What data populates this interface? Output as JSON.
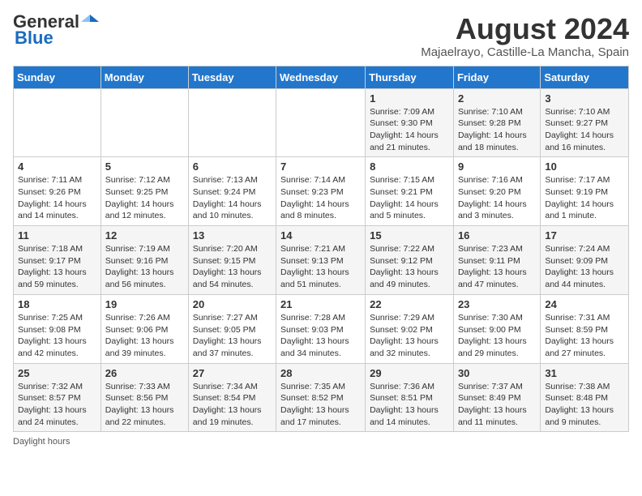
{
  "header": {
    "logo_general": "General",
    "logo_blue": "Blue",
    "title": "August 2024",
    "subtitle": "Majaelrayo, Castille-La Mancha, Spain"
  },
  "days_of_week": [
    "Sunday",
    "Monday",
    "Tuesday",
    "Wednesday",
    "Thursday",
    "Friday",
    "Saturday"
  ],
  "weeks": [
    [
      {
        "day": "",
        "info": ""
      },
      {
        "day": "",
        "info": ""
      },
      {
        "day": "",
        "info": ""
      },
      {
        "day": "",
        "info": ""
      },
      {
        "day": "1",
        "info": "Sunrise: 7:09 AM\nSunset: 9:30 PM\nDaylight: 14 hours and 21 minutes."
      },
      {
        "day": "2",
        "info": "Sunrise: 7:10 AM\nSunset: 9:28 PM\nDaylight: 14 hours and 18 minutes."
      },
      {
        "day": "3",
        "info": "Sunrise: 7:10 AM\nSunset: 9:27 PM\nDaylight: 14 hours and 16 minutes."
      }
    ],
    [
      {
        "day": "4",
        "info": "Sunrise: 7:11 AM\nSunset: 9:26 PM\nDaylight: 14 hours and 14 minutes."
      },
      {
        "day": "5",
        "info": "Sunrise: 7:12 AM\nSunset: 9:25 PM\nDaylight: 14 hours and 12 minutes."
      },
      {
        "day": "6",
        "info": "Sunrise: 7:13 AM\nSunset: 9:24 PM\nDaylight: 14 hours and 10 minutes."
      },
      {
        "day": "7",
        "info": "Sunrise: 7:14 AM\nSunset: 9:23 PM\nDaylight: 14 hours and 8 minutes."
      },
      {
        "day": "8",
        "info": "Sunrise: 7:15 AM\nSunset: 9:21 PM\nDaylight: 14 hours and 5 minutes."
      },
      {
        "day": "9",
        "info": "Sunrise: 7:16 AM\nSunset: 9:20 PM\nDaylight: 14 hours and 3 minutes."
      },
      {
        "day": "10",
        "info": "Sunrise: 7:17 AM\nSunset: 9:19 PM\nDaylight: 14 hours and 1 minute."
      }
    ],
    [
      {
        "day": "11",
        "info": "Sunrise: 7:18 AM\nSunset: 9:17 PM\nDaylight: 13 hours and 59 minutes."
      },
      {
        "day": "12",
        "info": "Sunrise: 7:19 AM\nSunset: 9:16 PM\nDaylight: 13 hours and 56 minutes."
      },
      {
        "day": "13",
        "info": "Sunrise: 7:20 AM\nSunset: 9:15 PM\nDaylight: 13 hours and 54 minutes."
      },
      {
        "day": "14",
        "info": "Sunrise: 7:21 AM\nSunset: 9:13 PM\nDaylight: 13 hours and 51 minutes."
      },
      {
        "day": "15",
        "info": "Sunrise: 7:22 AM\nSunset: 9:12 PM\nDaylight: 13 hours and 49 minutes."
      },
      {
        "day": "16",
        "info": "Sunrise: 7:23 AM\nSunset: 9:11 PM\nDaylight: 13 hours and 47 minutes."
      },
      {
        "day": "17",
        "info": "Sunrise: 7:24 AM\nSunset: 9:09 PM\nDaylight: 13 hours and 44 minutes."
      }
    ],
    [
      {
        "day": "18",
        "info": "Sunrise: 7:25 AM\nSunset: 9:08 PM\nDaylight: 13 hours and 42 minutes."
      },
      {
        "day": "19",
        "info": "Sunrise: 7:26 AM\nSunset: 9:06 PM\nDaylight: 13 hours and 39 minutes."
      },
      {
        "day": "20",
        "info": "Sunrise: 7:27 AM\nSunset: 9:05 PM\nDaylight: 13 hours and 37 minutes."
      },
      {
        "day": "21",
        "info": "Sunrise: 7:28 AM\nSunset: 9:03 PM\nDaylight: 13 hours and 34 minutes."
      },
      {
        "day": "22",
        "info": "Sunrise: 7:29 AM\nSunset: 9:02 PM\nDaylight: 13 hours and 32 minutes."
      },
      {
        "day": "23",
        "info": "Sunrise: 7:30 AM\nSunset: 9:00 PM\nDaylight: 13 hours and 29 minutes."
      },
      {
        "day": "24",
        "info": "Sunrise: 7:31 AM\nSunset: 8:59 PM\nDaylight: 13 hours and 27 minutes."
      }
    ],
    [
      {
        "day": "25",
        "info": "Sunrise: 7:32 AM\nSunset: 8:57 PM\nDaylight: 13 hours and 24 minutes."
      },
      {
        "day": "26",
        "info": "Sunrise: 7:33 AM\nSunset: 8:56 PM\nDaylight: 13 hours and 22 minutes."
      },
      {
        "day": "27",
        "info": "Sunrise: 7:34 AM\nSunset: 8:54 PM\nDaylight: 13 hours and 19 minutes."
      },
      {
        "day": "28",
        "info": "Sunrise: 7:35 AM\nSunset: 8:52 PM\nDaylight: 13 hours and 17 minutes."
      },
      {
        "day": "29",
        "info": "Sunrise: 7:36 AM\nSunset: 8:51 PM\nDaylight: 13 hours and 14 minutes."
      },
      {
        "day": "30",
        "info": "Sunrise: 7:37 AM\nSunset: 8:49 PM\nDaylight: 13 hours and 11 minutes."
      },
      {
        "day": "31",
        "info": "Sunrise: 7:38 AM\nSunset: 8:48 PM\nDaylight: 13 hours and 9 minutes."
      }
    ]
  ],
  "footer": {
    "note": "Daylight hours"
  }
}
